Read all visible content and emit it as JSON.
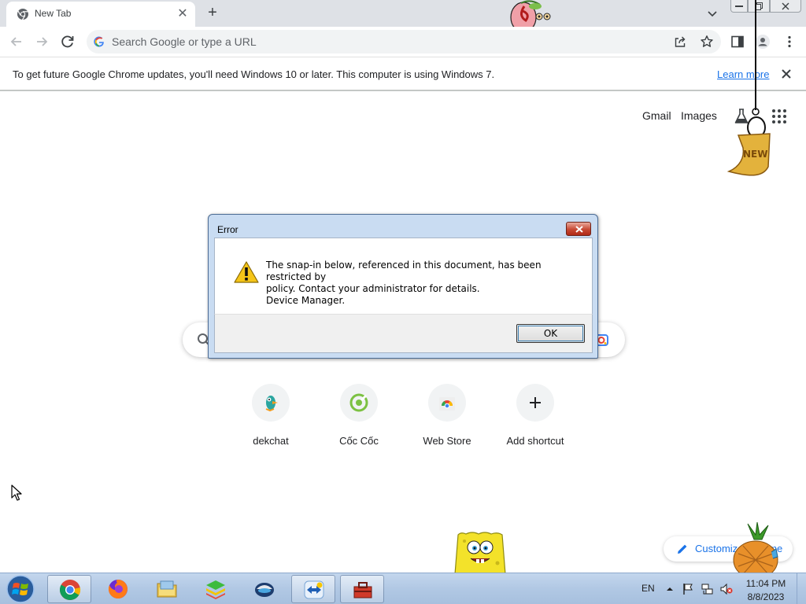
{
  "browser": {
    "tab": {
      "title": "New Tab"
    },
    "omnibox": {
      "placeholder": "Search Google or type a URL"
    }
  },
  "infobar": {
    "message": "To get future Google Chrome updates, you'll need Windows 10 or later. This computer is using Windows 7.",
    "link": "Learn more"
  },
  "ntp": {
    "header_links": [
      "Gmail",
      "Images"
    ],
    "shortcuts": [
      {
        "label": "dekchat",
        "icon": "dekchat-icon"
      },
      {
        "label": "Cốc Cốc",
        "icon": "coccoc-icon"
      },
      {
        "label": "Web Store",
        "icon": "webstore-icon"
      },
      {
        "label": "Add shortcut",
        "icon": "plus-icon"
      }
    ],
    "customize": "Customize Chrome"
  },
  "stickers": {
    "new_sign": "NEW"
  },
  "dialog": {
    "title": "Error",
    "message_lines": [
      "The snap-in below, referenced in this document, has been restricted by",
      "policy. Contact your administrator for details.",
      "Device Manager."
    ],
    "ok": "OK"
  },
  "taskbar": {
    "apps": [
      "Google Chrome",
      "Firefox",
      "Windows Explorer",
      "BlueStacks",
      "UltraViewer",
      "TeamViewer",
      "Toolbox"
    ],
    "language": "EN",
    "time": "11:04 PM",
    "date": "8/8/2023"
  },
  "colors": {
    "accent": "#1a73e8",
    "tabstrip": "#dee1e6",
    "taskbar": "#b1c8e4",
    "dialog_frame": "#c9dcf2",
    "dialog_close": "#c74934"
  }
}
